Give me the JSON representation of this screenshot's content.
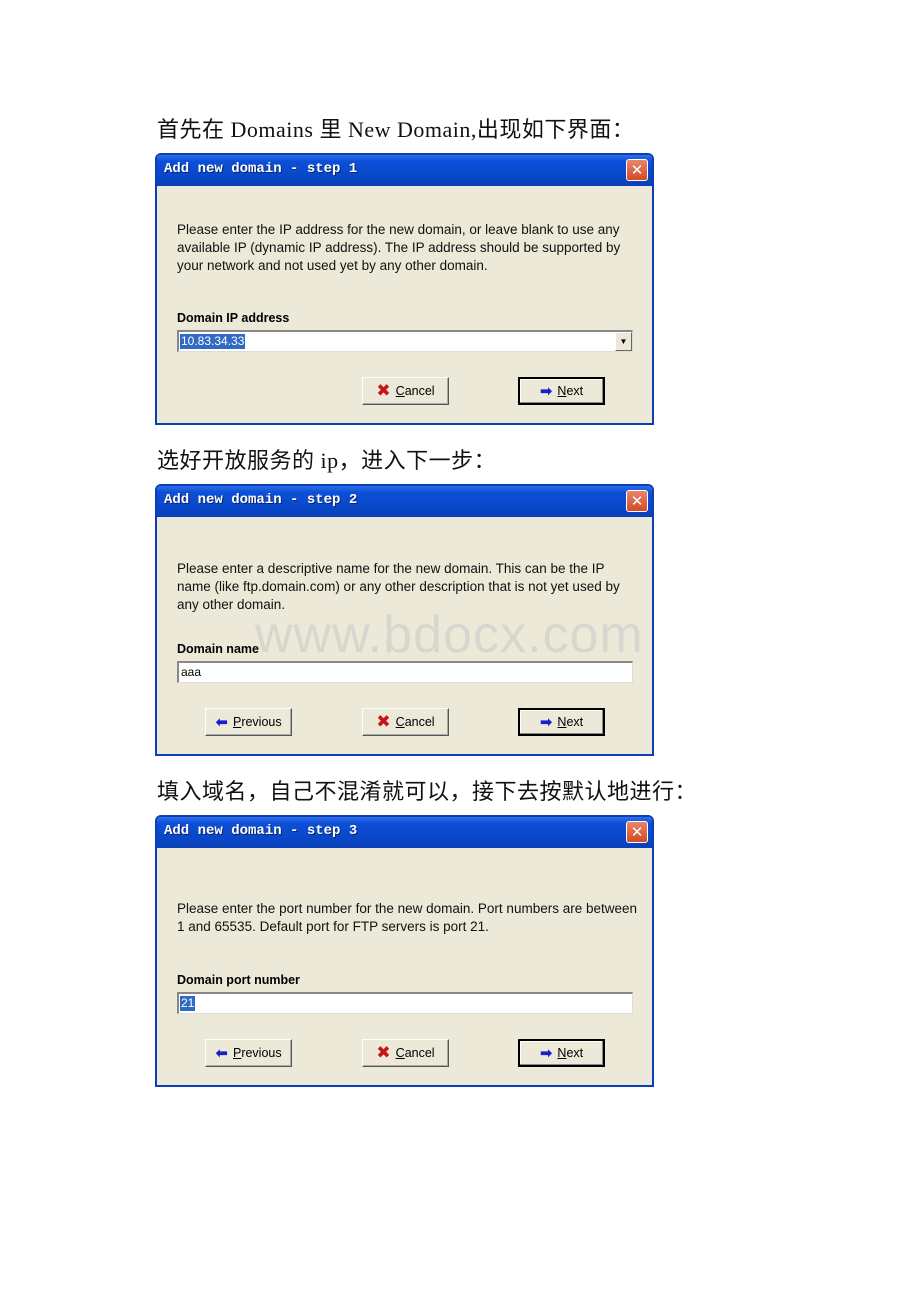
{
  "paragraphs": [
    "首先在 Domains 里 New Domain,出现如下界面：",
    "选好开放服务的 ip，进入下一步：",
    "填入域名，自己不混淆就可以，接下去按默认地进行："
  ],
  "watermark": "www.bdocx.com",
  "colors": {
    "titlebar": "#0a46c8",
    "dialog_bg": "#ece9d8",
    "close_button": "#d24a24",
    "selection": "#316ac5"
  },
  "dialogs": [
    {
      "title": "Add new domain - step 1",
      "description": "Please enter the IP address for the new domain, or leave blank to use any available IP (dynamic IP address). The IP address should be supported by your network and not used yet by any other domain.",
      "field_label": "Domain IP address",
      "field_value": "10.83.34.33",
      "field_type": "combobox",
      "buttons": {
        "cancel": {
          "first": "C",
          "rest": "ancel"
        },
        "next": {
          "first": "N",
          "rest": "ext"
        }
      },
      "close_icon": "close-icon"
    },
    {
      "title": "Add new domain - step 2",
      "description": "Please enter a descriptive name for the new domain. This can be the IP name (like ftp.domain.com) or any other description that is not yet used by any other domain.",
      "field_label": "Domain name",
      "field_value": "aaa",
      "field_type": "text",
      "buttons": {
        "previous": {
          "first": "P",
          "rest": "revious"
        },
        "cancel": {
          "first": "C",
          "rest": "ancel"
        },
        "next": {
          "first": "N",
          "rest": "ext"
        }
      },
      "close_icon": "close-icon"
    },
    {
      "title": "Add new domain - step 3",
      "description": "Please enter the port number for the new domain. Port numbers are between 1 and 65535. Default port for FTP servers is port 21.",
      "field_label": "Domain port number",
      "field_value": "21",
      "field_type": "text",
      "buttons": {
        "previous": {
          "first": "P",
          "rest": "revious"
        },
        "cancel": {
          "first": "C",
          "rest": "ancel"
        },
        "next": {
          "first": "N",
          "rest": "ext"
        }
      },
      "close_icon": "close-icon"
    }
  ]
}
